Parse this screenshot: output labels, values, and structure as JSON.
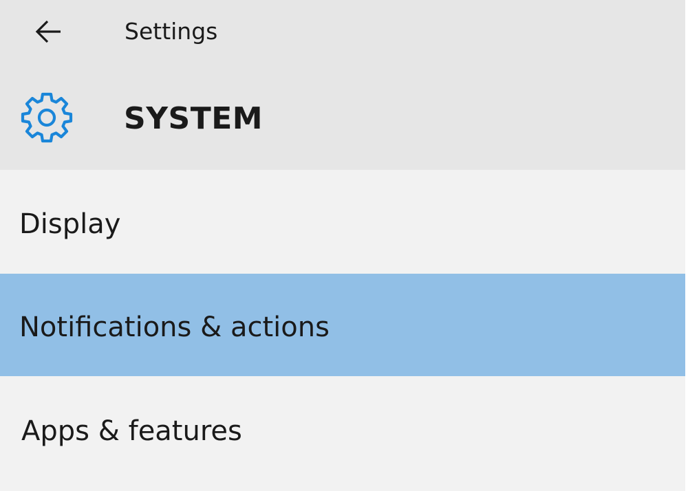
{
  "window": {
    "title": "Settings",
    "back_icon": "back-arrow-icon"
  },
  "section": {
    "icon": "gear-icon",
    "title": "SYSTEM",
    "accent_color": "#1a86d9"
  },
  "nav": {
    "items": [
      {
        "label": "Display",
        "selected": false
      },
      {
        "label": "Notifications & actions",
        "selected": true
      },
      {
        "label": "Apps & features",
        "selected": false
      }
    ],
    "selected_color": "#91bfe6"
  }
}
